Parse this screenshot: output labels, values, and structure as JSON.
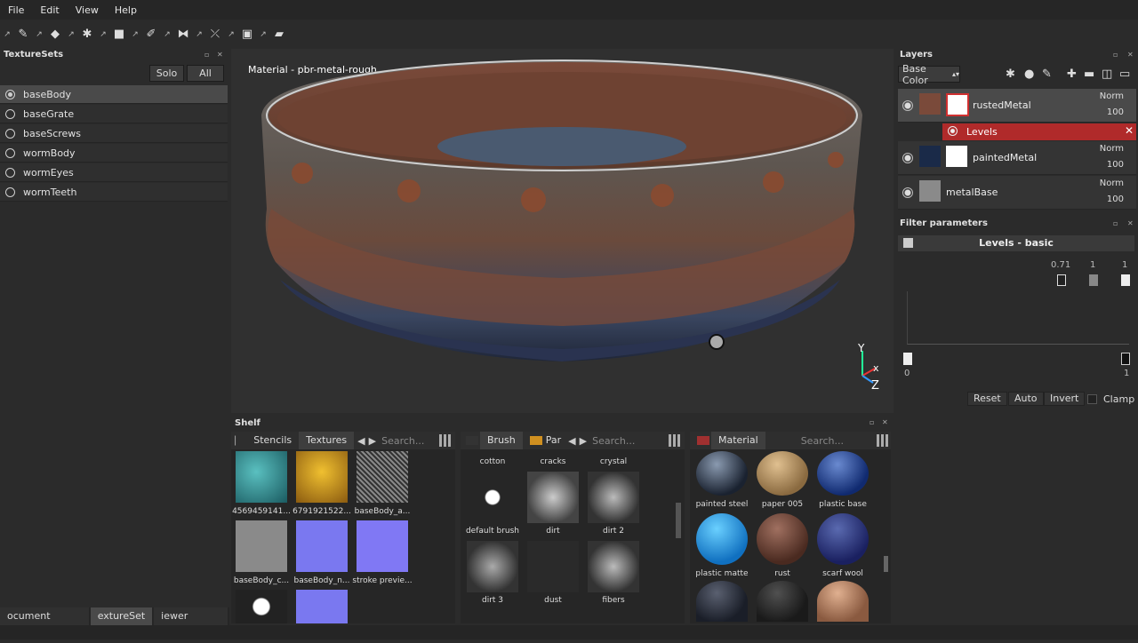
{
  "menu": {
    "items": [
      "File",
      "Edit",
      "View",
      "Help"
    ]
  },
  "texturesets": {
    "title": "TextureSets",
    "solo_label": "Solo",
    "all_label": "All",
    "items": [
      "baseBody",
      "baseGrate",
      "baseScrews",
      "wormBody",
      "wormEyes",
      "wormTeeth"
    ],
    "selected": "baseBody"
  },
  "bottom_tabs": [
    "ocument Setting",
    "extureSet",
    "iewer Setting"
  ],
  "viewport": {
    "material_label": "Material - pbr-metal-rough",
    "axis_y": "Y",
    "axis_x": "x",
    "axis_z": "Z"
  },
  "shelf": {
    "title": "Shelf",
    "panel1": {
      "tabs": [
        "Stencils",
        "Textures"
      ],
      "active_tab": "Textures",
      "search_placeholder": "Search...",
      "items": [
        "4569459141...",
        "6791921522...",
        "baseBody_a...",
        "baseBody_c...",
        "baseBody_n...",
        "stroke previe..."
      ]
    },
    "panel2": {
      "tabs": [
        "Brush",
        "Par"
      ],
      "active_tab": "Brush",
      "search_placeholder": "Search...",
      "items": [
        "cotton",
        "cracks",
        "crystal",
        "default brush",
        "dirt",
        "dirt 2",
        "dirt 3",
        "dust",
        "fibers"
      ]
    },
    "panel3": {
      "tabs": [
        "Material"
      ],
      "search_placeholder": "Search...",
      "items": [
        "painted steel",
        "paper 005",
        "plastic base",
        "plastic matte",
        "rust",
        "scarf wool"
      ]
    }
  },
  "layers": {
    "title": "Layers",
    "channel": "Base Color",
    "items": [
      {
        "name": "rustedMetal",
        "mode": "Norm",
        "opacity": "100"
      },
      {
        "name": "paintedMetal",
        "mode": "Norm",
        "opacity": "100"
      },
      {
        "name": "metalBase",
        "mode": "Norm",
        "opacity": "100"
      }
    ],
    "effect": "Levels"
  },
  "filter": {
    "title": "Filter parameters",
    "name": "Levels - basic",
    "values": [
      "0.71",
      "1",
      "1"
    ],
    "range_min": "0",
    "range_max": "1",
    "buttons": [
      "Reset",
      "Auto",
      "Invert"
    ],
    "clamp_label": "Clamp"
  },
  "colors": {
    "accent_red": "#b02a2a",
    "panel_bg": "#2b2b2b"
  }
}
